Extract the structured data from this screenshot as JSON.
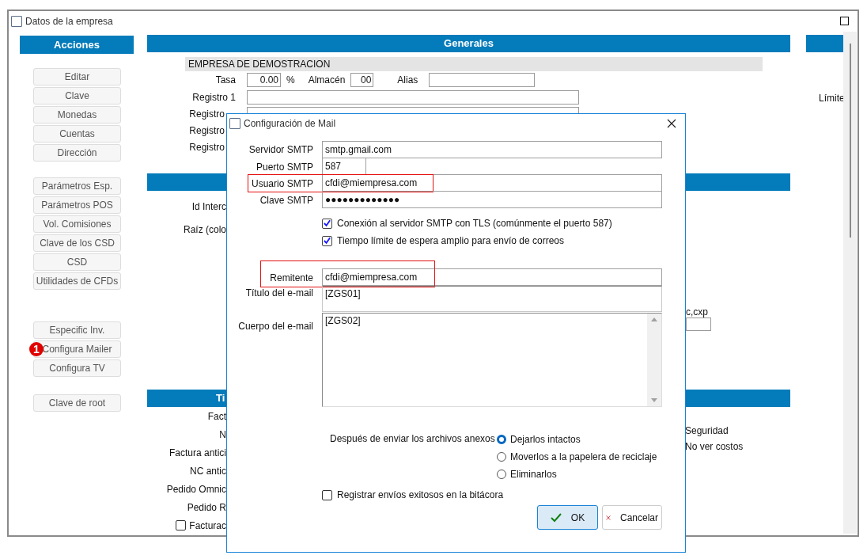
{
  "window": {
    "title": "Datos de la empresa"
  },
  "actions": {
    "title": "Acciones",
    "groups": [
      [
        {
          "label": "Editar"
        },
        {
          "label": "Clave"
        },
        {
          "label": "Monedas"
        },
        {
          "label": "Cuentas"
        },
        {
          "label": "Dirección"
        }
      ],
      [
        {
          "label": "Parámetros Esp."
        },
        {
          "label": "Parámetros POS"
        },
        {
          "label": "Vol. Comisiones"
        },
        {
          "label": "Clave de los CSD"
        },
        {
          "label": "CSD"
        },
        {
          "label": "Utilidades de CFDs"
        }
      ],
      [
        {
          "label": "Especific Inv."
        },
        {
          "label": "Configura Mailer",
          "badge": "1"
        },
        {
          "label": "Configura TV"
        }
      ],
      [
        {
          "label": "Clave de root"
        }
      ]
    ]
  },
  "generales": {
    "title": "Generales",
    "company": "EMPRESA DE DEMOSTRACION",
    "tasa_label": "Tasa",
    "tasa": "0.00",
    "percent": "%",
    "almacen_label": "Almacén",
    "almacen": "00",
    "alias_label": "Alias",
    "registros": [
      {
        "label": "Registro 1"
      },
      {
        "label": "Registro"
      },
      {
        "label": "Registro"
      },
      {
        "label": "Registro"
      }
    ]
  },
  "section_2": {
    "labels": [
      "Id Interc",
      "Raíz (colo"
    ],
    "note": "c,cxp"
  },
  "section_3": {
    "title": "Ti",
    "labels": [
      "Fact",
      "N",
      "Factura antici",
      "NC antic",
      "Pedido Omnic",
      "Pedido R"
    ],
    "checkbox": {
      "label": "Facturac",
      "checked": false
    },
    "right_labels": [
      "Seguridad",
      "No ver costos"
    ]
  },
  "right_panel": {
    "label": "Límite"
  },
  "mail_dialog": {
    "title": "Configuración de Mail",
    "fields": [
      {
        "label": "Servidor SMTP",
        "value": "smtp.gmail.com",
        "highlighted": false
      },
      {
        "label": "Puerto SMTP",
        "value": "587",
        "highlighted": false
      },
      {
        "label": "Usuario SMTP",
        "value": "cfdi@miempresa.com",
        "highlighted": true
      },
      {
        "label": "Clave SMTP",
        "value": "●●●●●●●●●●●●●",
        "highlighted": false
      }
    ],
    "options": [
      {
        "label": "Conexión al servidor SMTP con TLS (comúnmente el puerto 587)",
        "checked": true
      },
      {
        "label": "Tiempo límite de espera amplio para envío de correos",
        "checked": true
      }
    ],
    "sender": {
      "label": "Remitente",
      "value": "cfdi@miempresa.com",
      "highlighted": true
    },
    "subject": {
      "label": "Título del e-mail",
      "value": "[ZGS01]"
    },
    "body": {
      "label": "Cuerpo del e-mail",
      "value": "[ZGS02]"
    },
    "after_send": {
      "label": "Después de enviar los archivos anexos",
      "choices": [
        {
          "label": "Dejarlos intactos",
          "selected": true
        },
        {
          "label": "Moverlos a la papelera de reciclaje",
          "selected": false
        },
        {
          "label": "Eliminarlos",
          "selected": false
        }
      ]
    },
    "log": {
      "label": "Registrar envíos exitosos en la bitácora",
      "checked": false
    },
    "buttons": [
      {
        "label": "OK",
        "kind": "ok",
        "selected": true
      },
      {
        "label": "Cancelar",
        "kind": "cancel",
        "selected": false
      }
    ]
  }
}
